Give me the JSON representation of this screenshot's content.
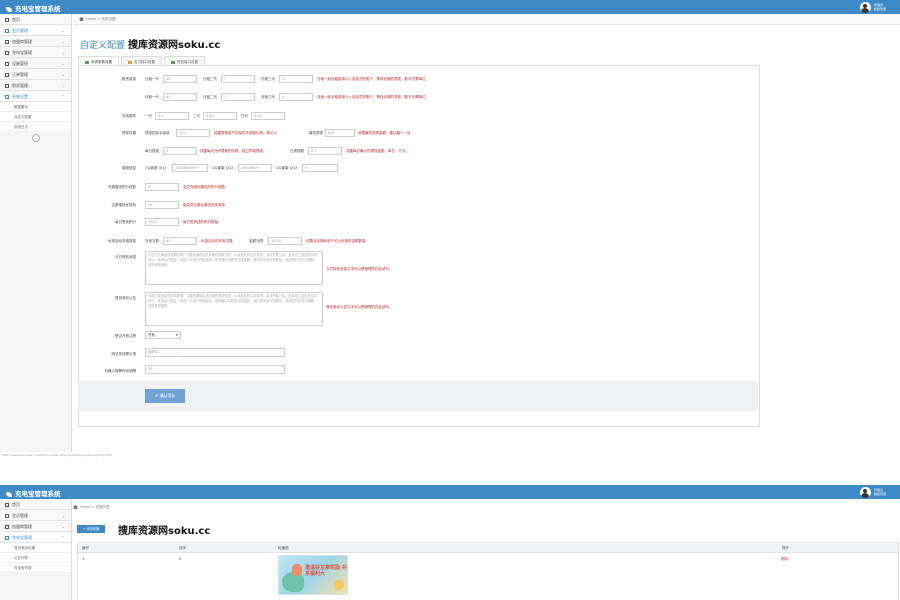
{
  "app": {
    "title": "充电宝管理系统",
    "user_name": "管理员",
    "user_role": "超级管理"
  },
  "sidebar": {
    "items": [
      {
        "label": "首页",
        "icon": "home-icon",
        "active": false
      },
      {
        "label": "会员管理",
        "icon": "users-icon",
        "active": true
      },
      {
        "label": "加盟商管理",
        "icon": "store-icon",
        "active": false
      },
      {
        "label": "充电宝管理",
        "icon": "battery-icon",
        "active": false
      },
      {
        "label": "设备管理",
        "icon": "device-icon",
        "active": false
      },
      {
        "label": "订单管理",
        "icon": "list-icon",
        "active": false
      },
      {
        "label": "财务管理",
        "icon": "money-icon",
        "active": false
      },
      {
        "label": "系统设置",
        "icon": "gear-icon",
        "active": true
      }
    ],
    "subitems": [
      "数据备份",
      "自定义配置",
      "系统日志"
    ]
  },
  "breadcrumb": {
    "home": "Home",
    "current": "系统设置"
  },
  "page": {
    "title": "自定义配置",
    "watermark": "搜库资源网soku.cc"
  },
  "tabs": [
    "系统参数设置",
    "支付接口设置",
    "短信接口设置"
  ],
  "form": {
    "row1": {
      "label": "租赁费用",
      "f1_pfx": "日租一代",
      "f1_val": "42",
      "f2_pfx": "日租二代",
      "f2_val": "7",
      "f3_pfx": "日租三代",
      "f3_val": "4",
      "hint": "日租一起出租费用计入到会员的账户，等待后期的提现，数字无需单位。"
    },
    "row2": {
      "f1_pfx": "月租一代",
      "f1_val": "42",
      "f2_pfx": "月租二代",
      "f2_val": "7",
      "f3_pfx": "月租三代",
      "f3_val": "4",
      "hint": "月租一起出租费用计入到会员的账户，等待后期的提现，数字无需单位。"
    },
    "row3": {
      "label": "充电服务",
      "f1_pfx": "一代",
      "f1_val": "0.5",
      "f2_pfx": "二代",
      "f2_val": "0.15",
      "f3_pfx": "日代",
      "f3_val": "0.05"
    },
    "row4": {
      "label": "提现设置",
      "f1_pfx": "提现扣除手续费",
      "f1_val": "100",
      "hint1": "设置提现用户扣除的手续费比例，单位%",
      "f2_pfx": "最低提现",
      "f2_val": "800",
      "hint2": "设置最低提现金额，建议最少一百。"
    },
    "row5": {
      "f1_pfx": "每日提现",
      "f1_val": "3",
      "hint1": "设置每天允许提现的次数，超过不能提现。",
      "f2_pfx": "日提现额",
      "f2_val": "2.2",
      "hint2": "设置每日最大的提现金额，单位：万元。"
    },
    "row6": {
      "label": "客服信息",
      "f1_pfx": "QQ客服 QQ1",
      "f1_val": "25436699977",
      "f2_pfx": "QQ客服 QQ2",
      "f2_val": "25436699",
      "f3_pfx": "QQ客服 QQ3",
      "f3_val": "0"
    },
    "row7": {
      "label": "充值赠送积分倍数",
      "val": "5",
      "hint": "会员充值时赠送的积分倍数。"
    },
    "row8": {
      "label": "注册赠送优惠券",
      "val": "10",
      "hint": "新会员注册后赠送的优惠券。"
    },
    "row9": {
      "label": "每日签到积分",
      "val": "1010",
      "hint": "每日签到送的积分数量。"
    },
    "row10": {
      "label": "优惠活动充电数量",
      "f1_pfx": "充电次数",
      "f1_val": "40",
      "hint1": "优惠活动的充电次数。",
      "f2_pfx": "金额元限",
      "f2_val": "100.0",
      "hint2": "设置活动期间用户可以优惠的金额数量。"
    },
    "row11": {
      "label": "今日特别消息",
      "text": "公告栏目消息的前期说明，主要是通知会员近期的更新情况，以及相关的注意事项。活动开展之际，全体员工及会员共同参与，系统运行稳定，欢迎广大用户积极使用，如有疑问请联系在线客服，我们将竭诚为您服务，感谢您的支持与理解，祝您使用愉快。",
      "hint": "今日特别消息文本可以是管理员在此填写。"
    },
    "row12": {
      "label": "首页滚动公告",
      "text": "公告栏目消息的前期说明，主要是通知会员近期的更新情况，以及相关的注意事项。活动开展之际，全体员工及会员共同参与，系统运行稳定，欢迎广大用户积极使用，如有疑问请联系在线客服，我们将竭诚为您服务，感谢您的支持与理解，祝您使用愉快。",
      "hint": "首页滚动公告文本可以是管理员在此填写。"
    },
    "row13": {
      "label": "是否开放注册",
      "val": "开放"
    },
    "row14": {
      "label": "网站关闭提示语",
      "val": "维护中，。。。。。。"
    },
    "row15": {
      "label": "机器人报警时间间隔",
      "val": "50"
    },
    "save_label": "确认保存"
  },
  "statusurl": "http://www.example.com/admin/index.php?s=/admin/system/config.html",
  "shot2": {
    "title": "充电宝管理系统",
    "breadcrumb_home": "Home",
    "breadcrumb_current": "轮播列表",
    "sidebar_items": [
      "首页",
      "会员管理",
      "加盟商管理",
      "充电宝管理"
    ],
    "sidebar_subitems": [
      "首页滚动轮播",
      "公告列表",
      "充电宝列表"
    ],
    "add_label": "+ 添加轮播",
    "watermark": "搜库资源网soku.cc",
    "columns": [
      "编号",
      "排序",
      "轮播图",
      "操作"
    ],
    "row": {
      "id": "1",
      "order": "0",
      "banner_text": "邀请好友拿奖励 共享福利大",
      "action": "删除"
    }
  }
}
